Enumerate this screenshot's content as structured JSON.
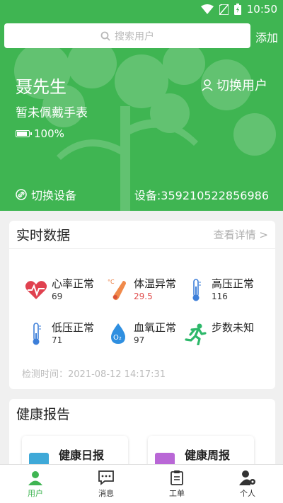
{
  "status": {
    "time": "10:50"
  },
  "search": {
    "placeholder": "搜索用户",
    "add_label": "添加"
  },
  "profile": {
    "name": "聂先生",
    "switch_user": "切换用户",
    "watch_status": "暂未佩戴手表",
    "battery": "100%",
    "battery_level": 1.0,
    "switch_device": "切换设备",
    "device": "设备:359210522856986"
  },
  "realtime": {
    "title": "实时数据",
    "more": "查看详情 >",
    "metrics": [
      {
        "name": "心率正常",
        "value": "69",
        "icon": "heart-rate-icon"
      },
      {
        "name": "体温异常",
        "value": "29.5",
        "icon": "thermometer-icon"
      },
      {
        "name": "高压正常",
        "value": "116",
        "icon": "thermometer-icon"
      },
      {
        "name": "低压正常",
        "value": "71",
        "icon": "thermometer-icon"
      },
      {
        "name": "血氧正常",
        "value": "97",
        "icon": "oxygen-drop-icon"
      },
      {
        "name": "步数未知",
        "value": "",
        "icon": "running-icon"
      }
    ],
    "check_time": "检测时间：2021-08-12 14:17:31"
  },
  "health": {
    "title": "健康报告",
    "daily": "健康日报",
    "weekly": "健康周报"
  },
  "tabs": [
    {
      "label": "用户",
      "icon": "user-icon"
    },
    {
      "label": "消息",
      "icon": "message-icon"
    },
    {
      "label": "工单",
      "icon": "clipboard-icon"
    },
    {
      "label": "个人",
      "icon": "user-settings-icon"
    }
  ],
  "colors": {
    "primary": "#3fb552",
    "alert": "#e04b4b",
    "tab_active": "#3fb552"
  }
}
